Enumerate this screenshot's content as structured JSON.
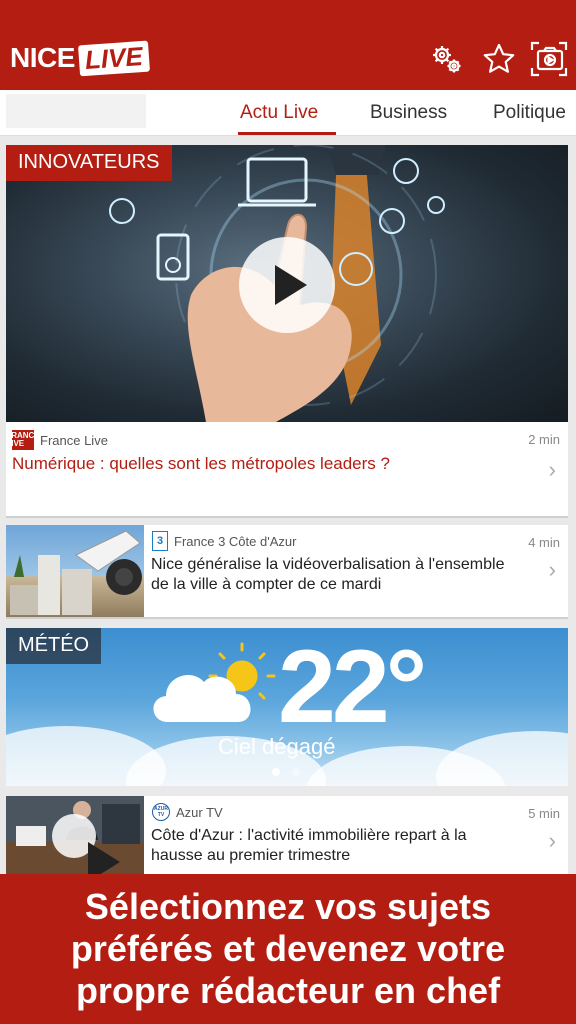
{
  "header": {
    "logo_nice": "NICE",
    "logo_live": "LIVE",
    "icons": [
      "settings-gears-icon",
      "star-icon",
      "video-camera-icon"
    ]
  },
  "tabs": [
    {
      "label": "Actu Live",
      "active": true
    },
    {
      "label": "Business",
      "active": false
    },
    {
      "label": "Politique",
      "active": false
    }
  ],
  "feed": {
    "hero": {
      "badge": "INNOVATEURS",
      "source_logo": "FRANCE LIVE",
      "source": "France Live",
      "time": "2 min",
      "headline": "Numérique : quelles sont les métropoles leaders ?"
    },
    "item1": {
      "source": "France 3 Côte d'Azur",
      "source_logo": "3",
      "time": "4 min",
      "headline_line1": "Nice généralise la vidéoverbalisation à l'ensemble",
      "headline_line2": "de la ville à compter de ce mardi"
    },
    "meteo": {
      "badge": "MÉTÉO",
      "temperature": "22°",
      "condition": "Ciel dégagé",
      "page_count": 2,
      "page_active": 1
    },
    "item2": {
      "source": "Azur TV",
      "source_logo": "AZUR TV",
      "time": "5 min",
      "headline_line1": "Côte d'Azur : l'activité immobilière repart à la",
      "headline_line2": "hausse au premier trimestre"
    }
  },
  "banner": {
    "line1": "Sélectionnez vos sujets",
    "line2": "préférés et devenez votre",
    "line3": "propre rédacteur en chef"
  },
  "colors": {
    "brand": "#b31d12",
    "link": "#b31d12"
  }
}
